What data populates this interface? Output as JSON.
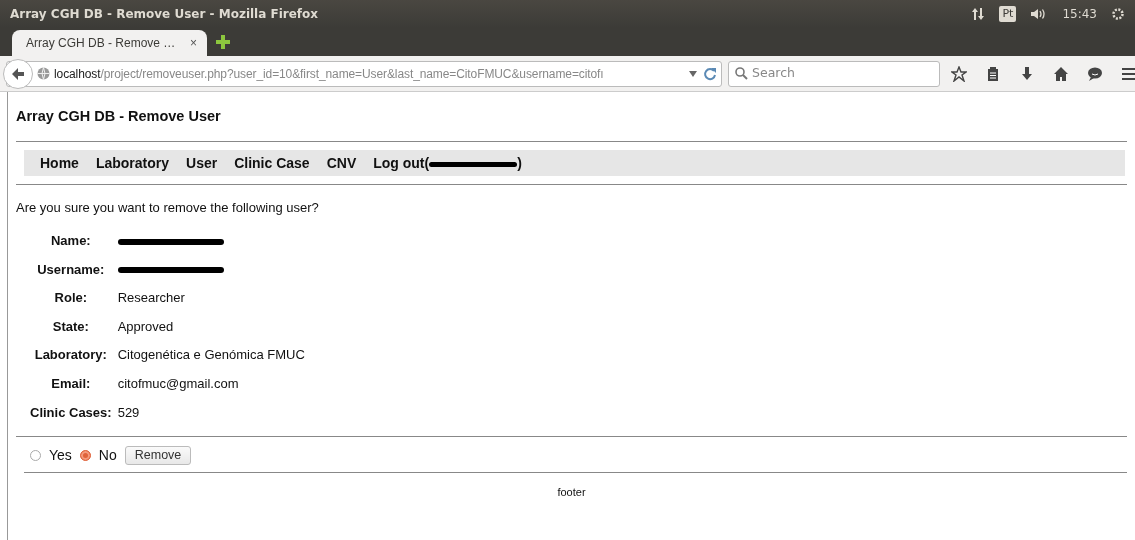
{
  "window": {
    "title": "Array CGH DB - Remove User - Mozilla Firefox"
  },
  "system_tray": {
    "keyboard": "Pt",
    "time": "15:43"
  },
  "tabs": [
    {
      "label": "Array CGH DB - Remove …",
      "close": "×",
      "selected": true
    }
  ],
  "address_bar": {
    "host": "localhost",
    "path": "/project/removeuser.php?user_id=10&first_name=User&last_name=CitoFMUC&username=citofı"
  },
  "search": {
    "placeholder": "Search"
  },
  "page": {
    "heading": "Array CGH DB - Remove User",
    "menu": [
      {
        "label": "Home"
      },
      {
        "label": "Laboratory"
      },
      {
        "label": "User"
      },
      {
        "label": "Clinic Case"
      },
      {
        "label": "CNV"
      },
      {
        "label": "Log out(",
        "redacted": true,
        "suffix": ")"
      }
    ],
    "question": "Are you sure you want to remove the following user?",
    "fields": [
      {
        "label": "Name:",
        "redacted": true
      },
      {
        "label": "Username:",
        "redacted": true
      },
      {
        "label": "Role:",
        "value": "Researcher"
      },
      {
        "label": "State:",
        "value": "Approved"
      },
      {
        "label": "Laboratory:",
        "value": "Citogenética e Genómica FMUC"
      },
      {
        "label": "Email:",
        "value": "citofmuc@gmail.com"
      },
      {
        "label": "Clinic Cases:",
        "value": "529"
      }
    ],
    "options": [
      {
        "label": "Yes",
        "selected": false
      },
      {
        "label": "No",
        "selected": true
      }
    ],
    "remove_button": "Remove",
    "footer": "footer"
  }
}
